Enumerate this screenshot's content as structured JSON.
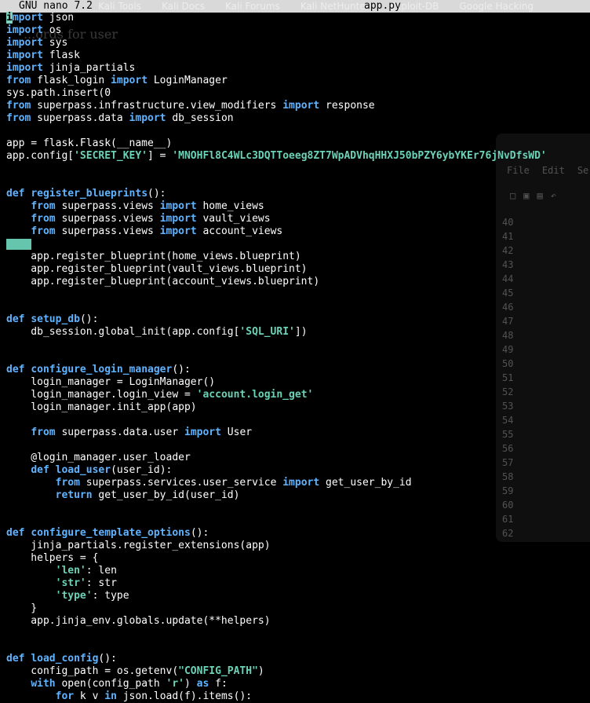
{
  "title_bar": {
    "app_name": "GNU nano 7.2",
    "file_name": "app.py",
    "background_tabs": [
      "Kali Tools",
      "Kali Docs",
      "Kali Forums",
      "Kali NetHunter",
      "Exploit-DB",
      "Google Hacking"
    ]
  },
  "background_doc_text": "...ords for user",
  "background_window": {
    "menu": [
      "File",
      "Edit",
      "Se"
    ],
    "toolbar_icons": [
      "new-file-icon",
      "open-icon",
      "save-icon",
      "undo-icon"
    ],
    "line_numbers": [
      "40",
      "41",
      "42",
      "43",
      "44",
      "45",
      "46",
      "47",
      "48",
      "49",
      "50",
      "51",
      "52",
      "53",
      "54",
      "55",
      "56",
      "57",
      "58",
      "59",
      "60",
      "61",
      "62"
    ]
  },
  "code_lines": [
    [
      [
        "cursor",
        "i"
      ],
      [
        "kw",
        "mport"
      ],
      [
        "t",
        " json"
      ]
    ],
    [
      [
        "kw",
        "import"
      ],
      [
        "t",
        " os"
      ]
    ],
    [
      [
        "kw",
        "import"
      ],
      [
        "t",
        " sys"
      ]
    ],
    [
      [
        "kw",
        "import"
      ],
      [
        "t",
        " flask"
      ]
    ],
    [
      [
        "kw",
        "import"
      ],
      [
        "t",
        " jinja_partials"
      ]
    ],
    [
      [
        "kw",
        "from"
      ],
      [
        "t",
        " flask_login "
      ],
      [
        "kw",
        "import"
      ],
      [
        "t",
        " LoginManager"
      ]
    ],
    [
      [
        "t",
        "sys.path.insert(0"
      ]
    ],
    [
      [
        "kw",
        "from"
      ],
      [
        "t",
        " superpass.infrastructure.view_modifiers "
      ],
      [
        "kw",
        "import"
      ],
      [
        "t",
        " response"
      ]
    ],
    [
      [
        "kw",
        "from"
      ],
      [
        "t",
        " superpass.data "
      ],
      [
        "kw",
        "import"
      ],
      [
        "t",
        " db_session"
      ]
    ],
    [],
    [
      [
        "t",
        "app = flask.Flask(__name__)"
      ]
    ],
    [
      [
        "t",
        "app.config["
      ],
      [
        "st",
        "'SECRET_KEY'"
      ],
      [
        "t",
        "] = "
      ],
      [
        "st",
        "'MNOHFl8C4WLc3DQTToeeg8ZT7WpADVhqHHXJ50bPZY6ybYKEr76jNvDfsWD'"
      ]
    ],
    [],
    [],
    [
      [
        "kw",
        "def"
      ],
      [
        "t",
        " "
      ],
      [
        "fn",
        "register_blueprints"
      ],
      [
        "t",
        "():"
      ]
    ],
    [
      [
        "t",
        "    "
      ],
      [
        "kw",
        "from"
      ],
      [
        "t",
        " superpass.views "
      ],
      [
        "kw",
        "import"
      ],
      [
        "t",
        " home_views"
      ]
    ],
    [
      [
        "t",
        "    "
      ],
      [
        "kw",
        "from"
      ],
      [
        "t",
        " superpass.views "
      ],
      [
        "kw",
        "import"
      ],
      [
        "t",
        " vault_views"
      ]
    ],
    [
      [
        "t",
        "    "
      ],
      [
        "kw",
        "from"
      ],
      [
        "t",
        " superpass.views "
      ],
      [
        "kw",
        "import"
      ],
      [
        "t",
        " account_views"
      ]
    ],
    [
      [
        "sel",
        ""
      ]
    ],
    [
      [
        "t",
        "    app.register_blueprint(home_views.blueprint)"
      ]
    ],
    [
      [
        "t",
        "    app.register_blueprint(vault_views.blueprint)"
      ]
    ],
    [
      [
        "t",
        "    app.register_blueprint(account_views.blueprint)"
      ]
    ],
    [],
    [],
    [
      [
        "kw",
        "def"
      ],
      [
        "t",
        " "
      ],
      [
        "fn",
        "setup_db"
      ],
      [
        "t",
        "():"
      ]
    ],
    [
      [
        "t",
        "    db_session.global_init(app.config["
      ],
      [
        "st",
        "'SQL_URI'"
      ],
      [
        "t",
        "])"
      ]
    ],
    [],
    [],
    [
      [
        "kw",
        "def"
      ],
      [
        "t",
        " "
      ],
      [
        "fn",
        "configure_login_manager"
      ],
      [
        "t",
        "():"
      ]
    ],
    [
      [
        "t",
        "    login_manager = LoginManager()"
      ]
    ],
    [
      [
        "t",
        "    login_manager.login_view = "
      ],
      [
        "st",
        "'account.login_get'"
      ]
    ],
    [
      [
        "t",
        "    login_manager.init_app(app)"
      ]
    ],
    [],
    [
      [
        "t",
        "    "
      ],
      [
        "kw",
        "from"
      ],
      [
        "t",
        " superpass.data.user "
      ],
      [
        "kw",
        "import"
      ],
      [
        "t",
        " User"
      ]
    ],
    [],
    [
      [
        "t",
        "    @login_manager.user_loader"
      ]
    ],
    [
      [
        "t",
        "    "
      ],
      [
        "kw",
        "def"
      ],
      [
        "t",
        " "
      ],
      [
        "fn",
        "load_user"
      ],
      [
        "t",
        "(user_id):"
      ]
    ],
    [
      [
        "t",
        "        "
      ],
      [
        "kw",
        "from"
      ],
      [
        "t",
        " superpass.services.user_service "
      ],
      [
        "kw",
        "import"
      ],
      [
        "t",
        " get_user_by_id"
      ]
    ],
    [
      [
        "t",
        "        "
      ],
      [
        "kw",
        "return"
      ],
      [
        "t",
        " get_user_by_id(user_id)"
      ]
    ],
    [],
    [],
    [
      [
        "kw",
        "def"
      ],
      [
        "t",
        " "
      ],
      [
        "fn",
        "configure_template_options"
      ],
      [
        "t",
        "():"
      ]
    ],
    [
      [
        "t",
        "    jinja_partials.register_extensions(app)"
      ]
    ],
    [
      [
        "t",
        "    helpers = {"
      ]
    ],
    [
      [
        "t",
        "        "
      ],
      [
        "st",
        "'len'"
      ],
      [
        "t",
        ": len"
      ]
    ],
    [
      [
        "t",
        "        "
      ],
      [
        "st",
        "'str'"
      ],
      [
        "t",
        ": str"
      ]
    ],
    [
      [
        "t",
        "        "
      ],
      [
        "st",
        "'type'"
      ],
      [
        "t",
        ": type"
      ]
    ],
    [
      [
        "t",
        "    }"
      ]
    ],
    [
      [
        "t",
        "    app.jinja_env.globals.update(**helpers)"
      ]
    ],
    [],
    [],
    [
      [
        "kw",
        "def"
      ],
      [
        "t",
        " "
      ],
      [
        "fn",
        "load_config"
      ],
      [
        "t",
        "():"
      ]
    ],
    [
      [
        "t",
        "    config_path = os.getenv("
      ],
      [
        "st",
        "\"CONFIG_PATH\""
      ],
      [
        "t",
        ")"
      ]
    ],
    [
      [
        "t",
        "    "
      ],
      [
        "kw",
        "with"
      ],
      [
        "t",
        " open(config_path "
      ],
      [
        "st",
        "'r'"
      ],
      [
        "t",
        ") "
      ],
      [
        "kw",
        "as"
      ],
      [
        "t",
        " f:"
      ]
    ],
    [
      [
        "t",
        "        "
      ],
      [
        "kw",
        "for"
      ],
      [
        "t",
        " k v "
      ],
      [
        "kw",
        "in"
      ],
      [
        "t",
        " json.load(f).items():"
      ]
    ]
  ]
}
